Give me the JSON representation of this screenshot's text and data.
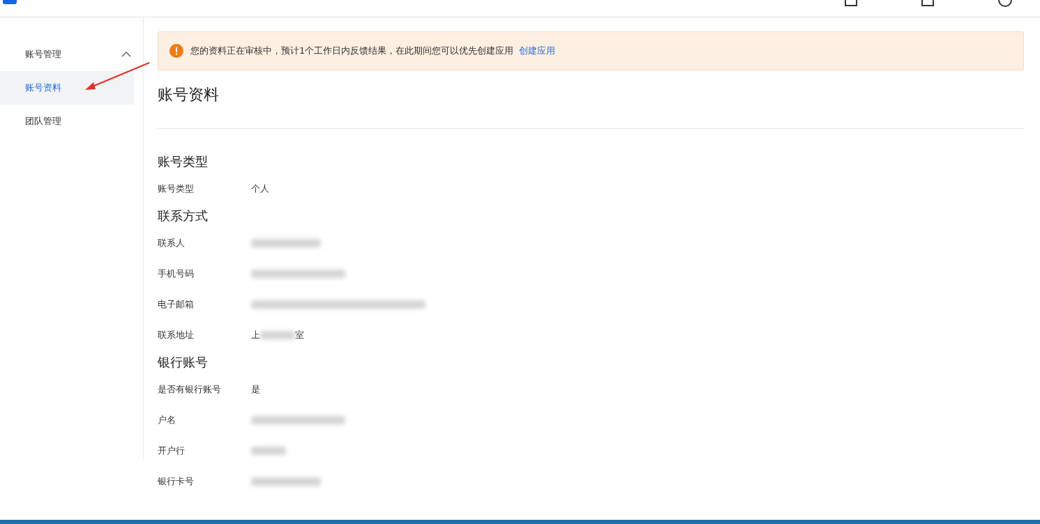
{
  "sidebar": {
    "group": {
      "label": "账号管理",
      "expanded": true
    },
    "items": [
      {
        "label": "账号资料",
        "selected": true
      },
      {
        "label": "团队管理",
        "selected": false
      }
    ]
  },
  "alert": {
    "message": "您的资料正在审核中，预计1个工作日内反馈结果，在此期间您可以优先创建应用",
    "link": "创建应用"
  },
  "page_title": "账号资料",
  "sections": [
    {
      "heading": "账号类型",
      "rows": [
        {
          "label": "账号类型",
          "value": "个人"
        }
      ]
    },
    {
      "heading": "联系方式",
      "rows": [
        {
          "label": "联系人",
          "redacted": true
        },
        {
          "label": "手机号码",
          "redacted": true
        },
        {
          "label": "电子邮箱",
          "redacted": true
        },
        {
          "label": "联系地址",
          "redacted": true,
          "prefix": "上",
          "suffix": "室"
        }
      ]
    },
    {
      "heading": "银行账号",
      "rows": [
        {
          "label": "是否有银行账号",
          "value": "是"
        },
        {
          "label": "户名",
          "redacted": true
        },
        {
          "label": "开户行",
          "redacted": true
        },
        {
          "label": "银行卡号",
          "redacted": true
        }
      ]
    }
  ]
}
